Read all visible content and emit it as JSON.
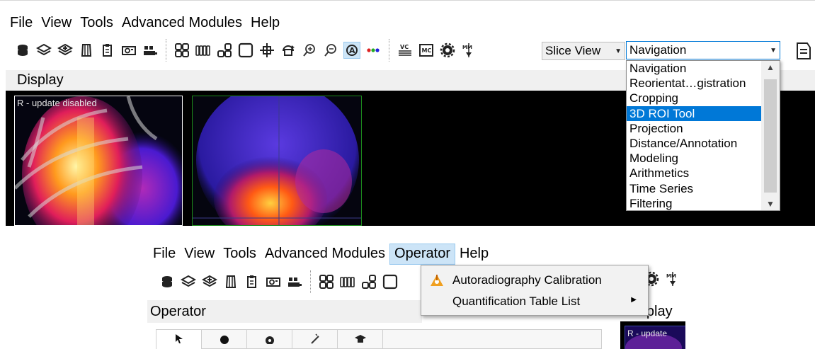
{
  "top": {
    "menu": [
      "File",
      "View",
      "Tools",
      "Advanced Modules",
      "Help"
    ],
    "display_title": "Display",
    "viewport_label": "R - update disabled",
    "slice_view_combo": "Slice View",
    "navigation_combo": "Navigation",
    "navigation_options": [
      "Navigation",
      "Reorientat…gistration",
      "Cropping",
      "3D ROI Tool",
      "Projection",
      "Distance/Annotation",
      "Modeling",
      "Arithmetics",
      "Time Series",
      "Filtering"
    ],
    "navigation_highlighted": "3D ROI Tool",
    "toolbar_icons": [
      "database-icon",
      "layers-icon",
      "layers-plus-icon",
      "body-icon",
      "clipboard-icon",
      "camera-icon",
      "sliders-icon",
      "grid-2x2-icon",
      "columns-icon",
      "layout-icon",
      "square-icon",
      "crosshair-icon",
      "rotate-3d-icon",
      "zoom-in-icon",
      "zoom-out-icon",
      "auto-icon",
      "rgb-dots-icon",
      "vc-icon",
      "mc-icon",
      "gear-icon",
      "mm-icon"
    ]
  },
  "bottom": {
    "menu": [
      "File",
      "View",
      "Tools",
      "Advanced Modules",
      "Operator",
      "Help"
    ],
    "open_menu": "Operator",
    "operator_title": "Operator",
    "display_title": "Display",
    "viewport_label": "R - update",
    "operator_menu": [
      {
        "label": "Autoradiography Calibration",
        "icon": "calibration-icon",
        "submenu": false
      },
      {
        "label": "Quantification Table List",
        "icon": "",
        "submenu": true
      }
    ],
    "operator_tabs": [
      "cursor-icon",
      "dot-icon",
      "gear-icon",
      "ruler-icon",
      "graduation-cap-icon"
    ]
  },
  "colors": {
    "selection": "#0078d7",
    "menu_highlight": "#cce4f7",
    "viewer_bg": "#000000"
  }
}
